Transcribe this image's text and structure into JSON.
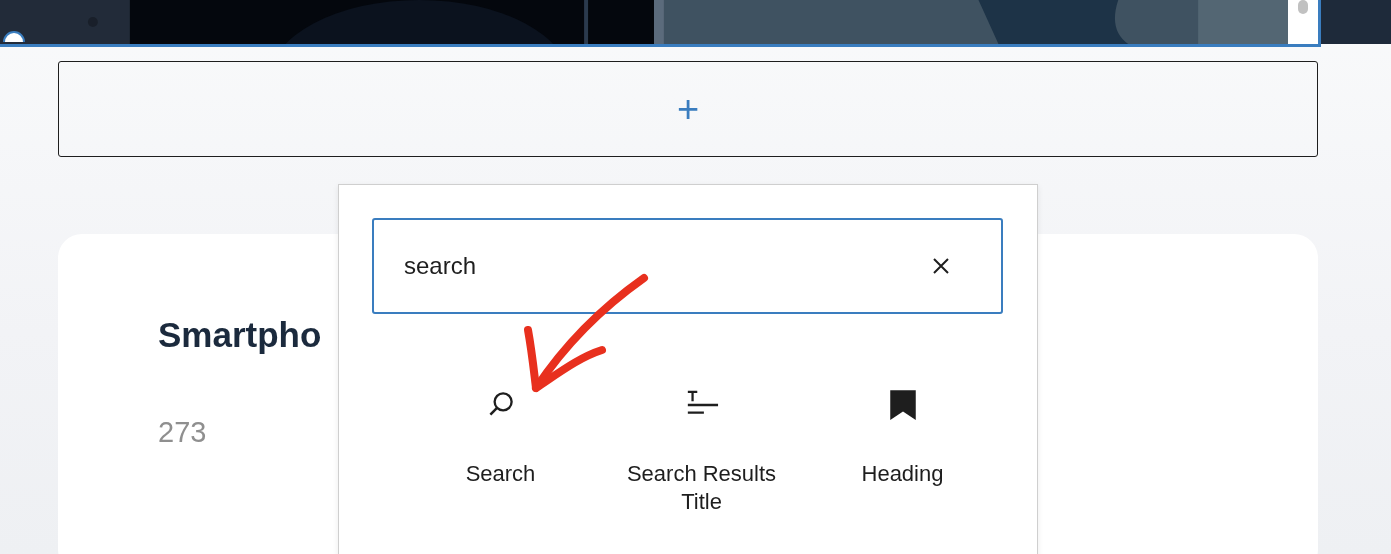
{
  "image_block": {
    "kind": "picture",
    "selected": true
  },
  "add_block": {
    "label": "+"
  },
  "card": {
    "title": "Smartpho",
    "count": "273"
  },
  "inserter": {
    "search": {
      "value": "search"
    },
    "results": [
      {
        "kind": "search",
        "label": "Search"
      },
      {
        "kind": "title",
        "label": "Search Results Title"
      },
      {
        "kind": "heading",
        "label": "Heading"
      }
    ]
  }
}
